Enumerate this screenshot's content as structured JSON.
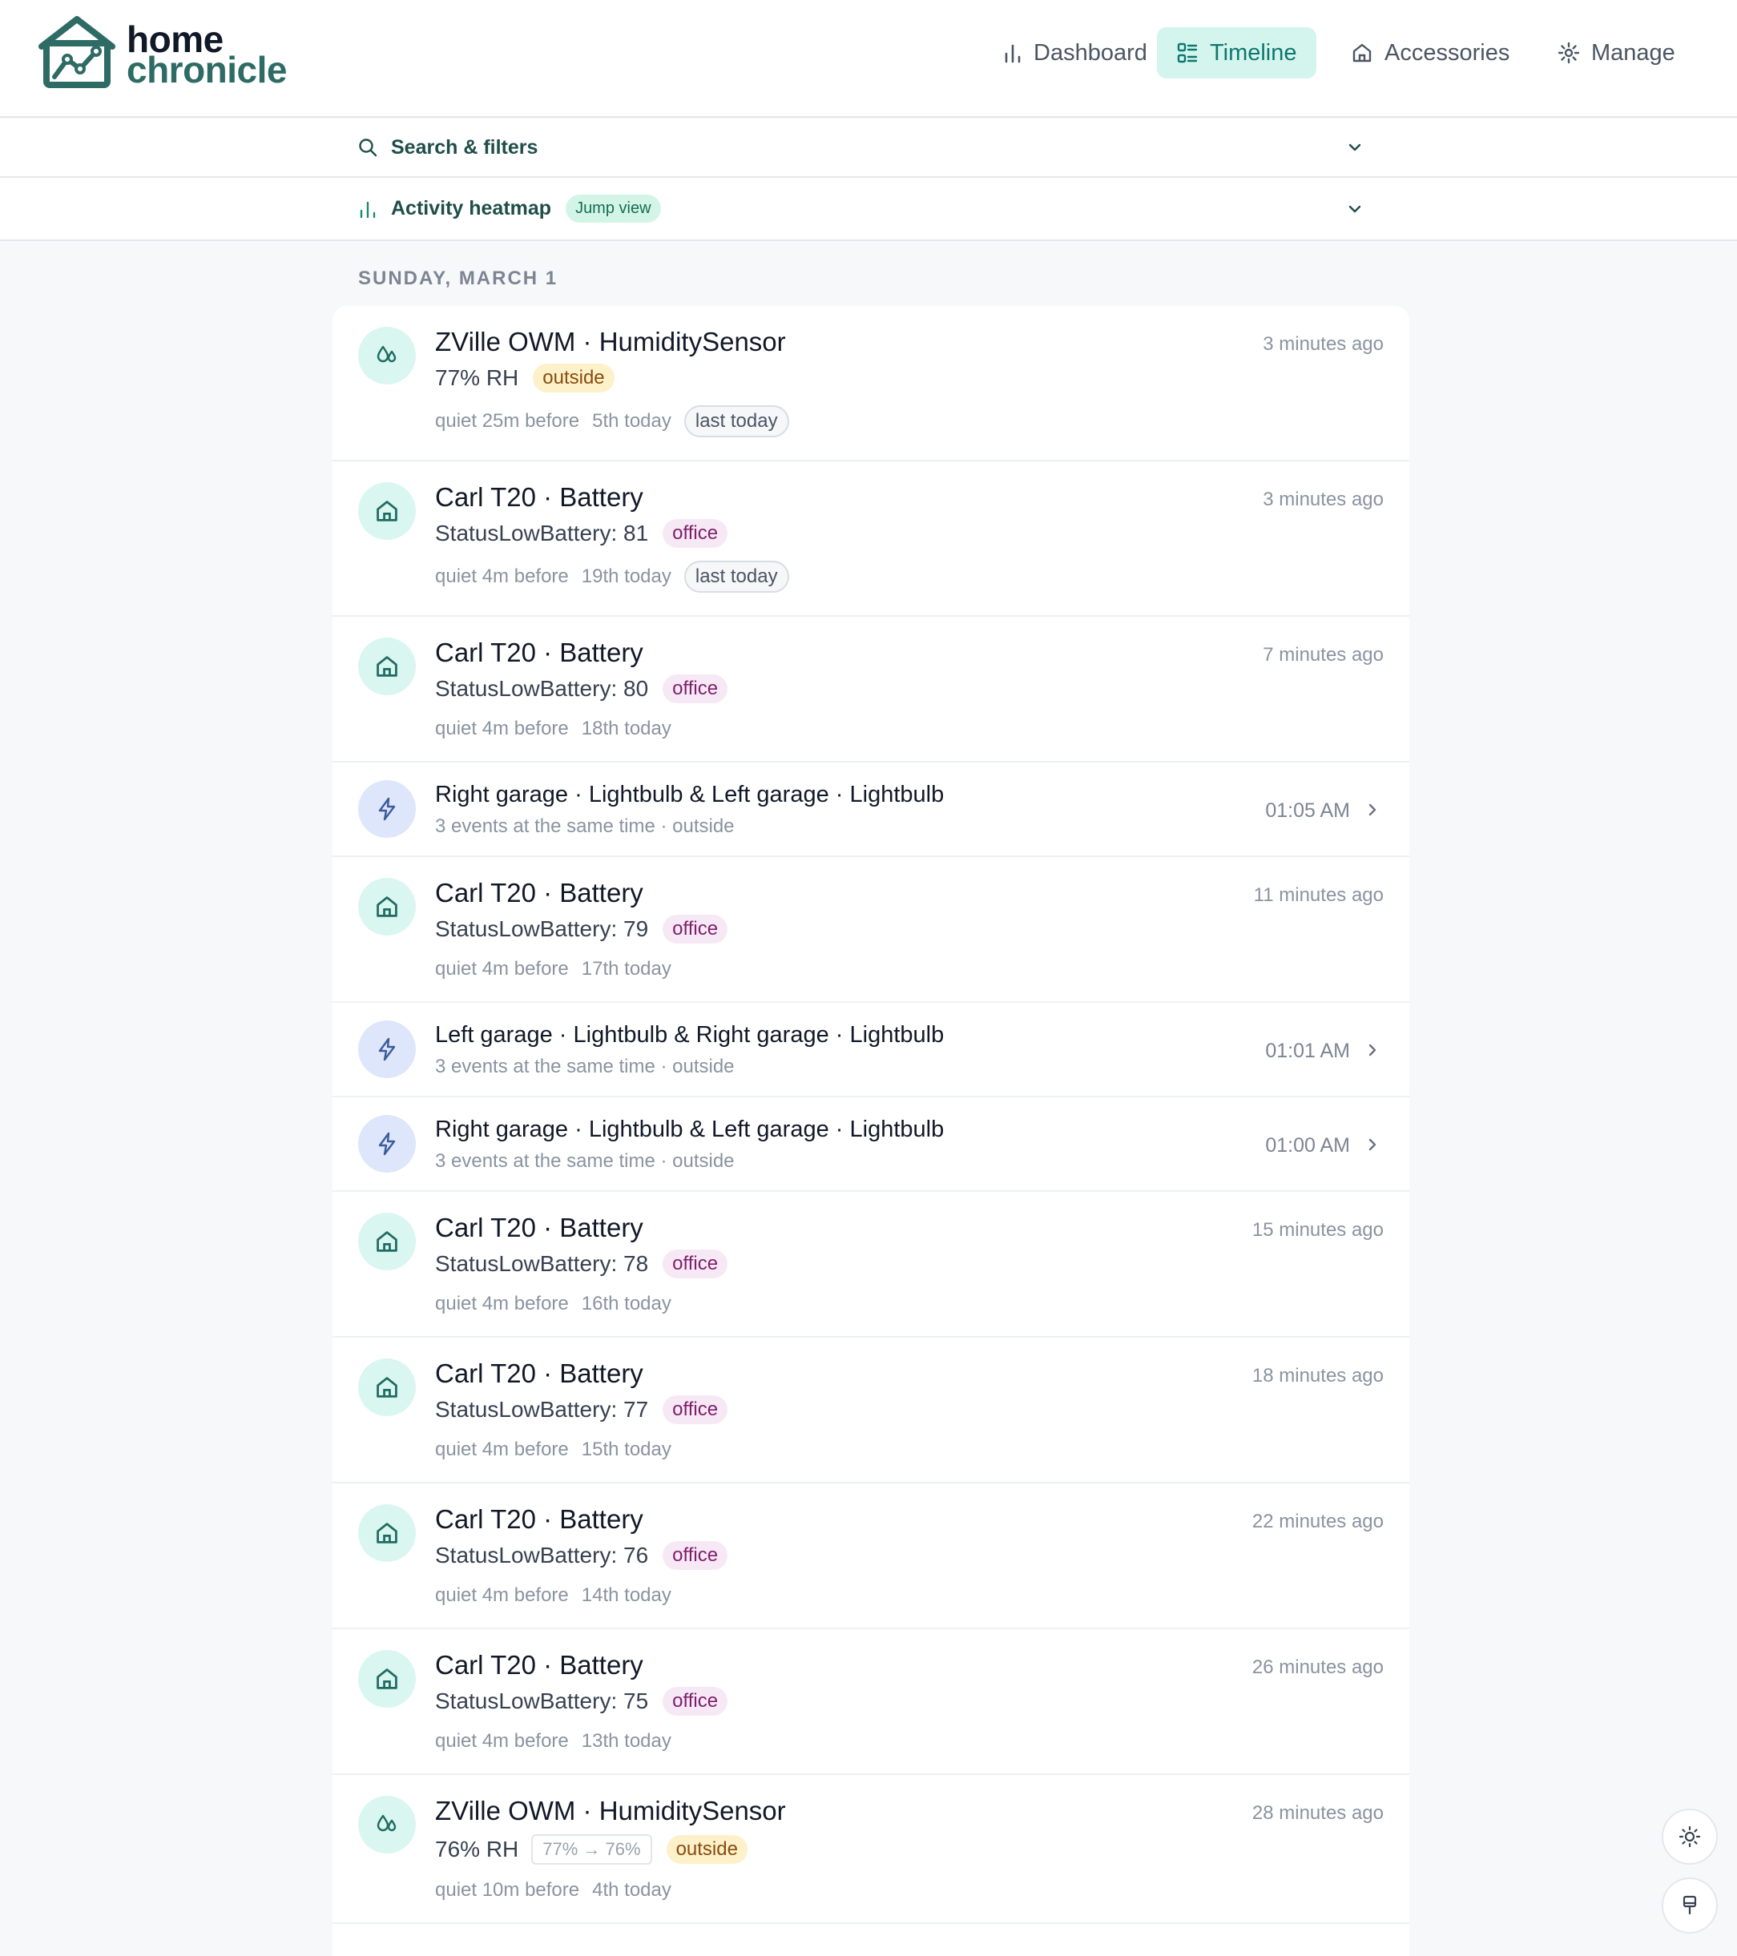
{
  "brand": {
    "line1": "home",
    "line2": "chronicle"
  },
  "nav": [
    {
      "label": "Dashboard",
      "icon": "bar-chart-icon",
      "active": false
    },
    {
      "label": "Timeline",
      "icon": "timeline-list-icon",
      "active": true
    },
    {
      "label": "Accessories",
      "icon": "house-icon",
      "active": false
    },
    {
      "label": "Manage",
      "icon": "gear-icon",
      "active": false
    }
  ],
  "search": {
    "label": "Search & filters"
  },
  "heatmap": {
    "label": "Activity heatmap",
    "badge": "Jump view"
  },
  "day": {
    "label": "SUNDAY, MARCH 1"
  },
  "events": [
    {
      "type": "single",
      "icon": "humidity-icon",
      "title": "ZVille OWM · HumiditySensor",
      "value": "77% RH",
      "tag": "outside",
      "quiet": "quiet 25m before",
      "ordinal": "5th today",
      "last": "last today",
      "time": "3 minutes ago"
    },
    {
      "type": "single",
      "icon": "house-icon",
      "title": "Carl T20 · Battery",
      "value": "StatusLowBattery: 81",
      "tag": "office",
      "quiet": "quiet 4m before",
      "ordinal": "19th today",
      "last": "last today",
      "time": "3 minutes ago"
    },
    {
      "type": "single",
      "icon": "house-icon",
      "title": "Carl T20 · Battery",
      "value": "StatusLowBattery: 80",
      "tag": "office",
      "quiet": "quiet 4m before",
      "ordinal": "18th today",
      "time": "7 minutes ago"
    },
    {
      "type": "group",
      "icon": "lightning-icon",
      "title": "Right garage · Lightbulb & Left garage · Lightbulb",
      "sub": "3 events at the same time · outside",
      "time": "01:05 AM"
    },
    {
      "type": "single",
      "icon": "house-icon",
      "title": "Carl T20 · Battery",
      "value": "StatusLowBattery: 79",
      "tag": "office",
      "quiet": "quiet 4m before",
      "ordinal": "17th today",
      "time": "11 minutes ago"
    },
    {
      "type": "group",
      "icon": "lightning-icon",
      "title": "Left garage · Lightbulb & Right garage · Lightbulb",
      "sub": "3 events at the same time · outside",
      "time": "01:01 AM"
    },
    {
      "type": "group",
      "icon": "lightning-icon",
      "title": "Right garage · Lightbulb & Left garage · Lightbulb",
      "sub": "3 events at the same time · outside",
      "time": "01:00 AM"
    },
    {
      "type": "single",
      "icon": "house-icon",
      "title": "Carl T20 · Battery",
      "value": "StatusLowBattery: 78",
      "tag": "office",
      "quiet": "quiet 4m before",
      "ordinal": "16th today",
      "time": "15 minutes ago"
    },
    {
      "type": "single",
      "icon": "house-icon",
      "title": "Carl T20 · Battery",
      "value": "StatusLowBattery: 77",
      "tag": "office",
      "quiet": "quiet 4m before",
      "ordinal": "15th today",
      "time": "18 minutes ago"
    },
    {
      "type": "single",
      "icon": "house-icon",
      "title": "Carl T20 · Battery",
      "value": "StatusLowBattery: 76",
      "tag": "office",
      "quiet": "quiet 4m before",
      "ordinal": "14th today",
      "time": "22 minutes ago"
    },
    {
      "type": "single",
      "icon": "house-icon",
      "title": "Carl T20 · Battery",
      "value": "StatusLowBattery: 75",
      "tag": "office",
      "quiet": "quiet 4m before",
      "ordinal": "13th today",
      "time": "26 minutes ago"
    },
    {
      "type": "single",
      "icon": "humidity-icon",
      "title": "ZVille OWM · HumiditySensor",
      "value": "76% RH",
      "delta": "77% → 76%",
      "tag": "outside",
      "quiet": "quiet 10m before",
      "ordinal": "4th today",
      "time": "28 minutes ago"
    }
  ],
  "floating": [
    {
      "icon": "sun-icon"
    },
    {
      "icon": "paint-brush-icon"
    }
  ],
  "colors": {
    "accent": "#0f766e",
    "accent_bg": "#d3f5ee",
    "brand": "#2d6b64",
    "outside_tag": "#fdf1c9",
    "office_tag": "#f7e8f5"
  }
}
